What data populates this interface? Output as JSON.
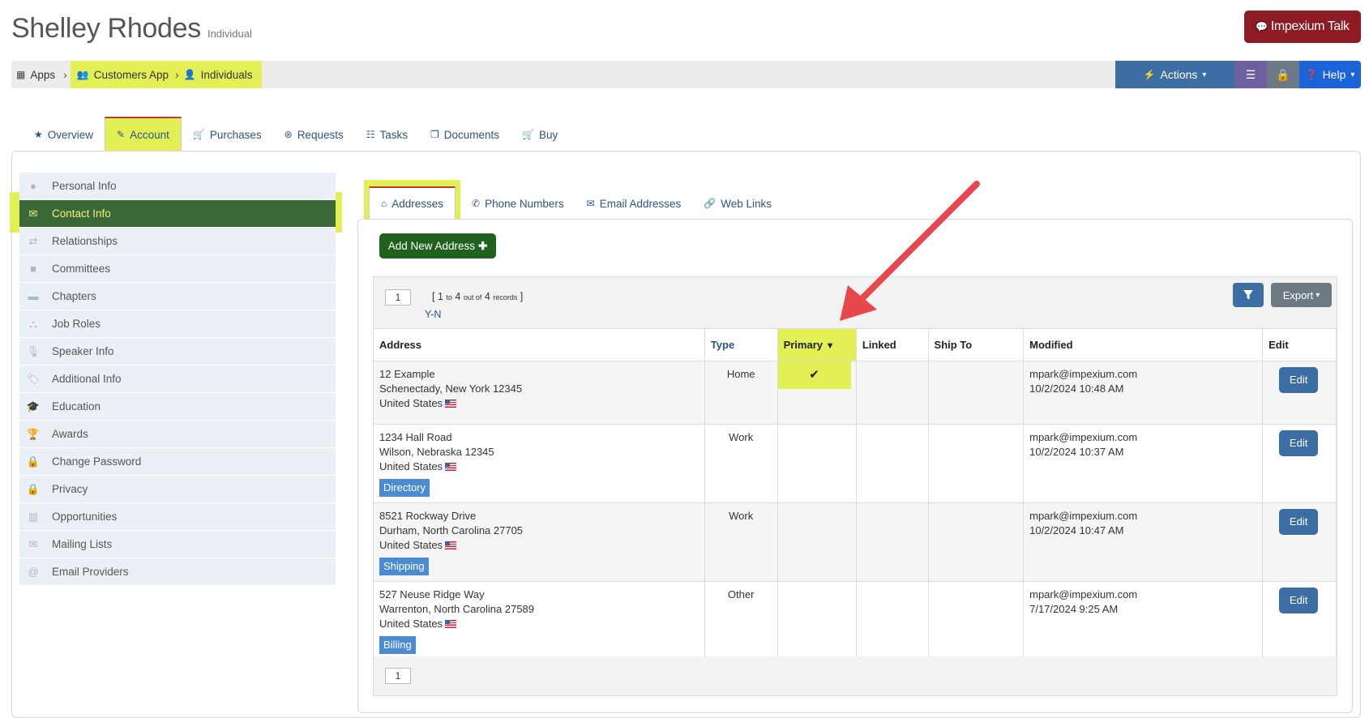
{
  "header": {
    "title": "Shelley Rhodes",
    "subtitle": "Individual",
    "talk_button": "Impexium Talk"
  },
  "breadcrumb": {
    "items": [
      "Apps",
      "Customers App",
      "Individuals"
    ]
  },
  "toolbar": {
    "actions_label": "Actions",
    "help_label": "Help"
  },
  "main_tabs": [
    {
      "label": "Overview",
      "icon": "star-icon"
    },
    {
      "label": "Account",
      "icon": "edit-icon",
      "active": true
    },
    {
      "label": "Purchases",
      "icon": "cart-icon"
    },
    {
      "label": "Requests",
      "icon": "lifebuoy-icon"
    },
    {
      "label": "Tasks",
      "icon": "checklist-icon"
    },
    {
      "label": "Documents",
      "icon": "documents-icon"
    },
    {
      "label": "Buy",
      "icon": "cart-icon"
    }
  ],
  "sidebar": {
    "items": [
      {
        "label": "Personal Info",
        "icon": "user-icon"
      },
      {
        "label": "Contact Info",
        "icon": "envelope-icon",
        "active": true
      },
      {
        "label": "Relationships",
        "icon": "retweet-icon"
      },
      {
        "label": "Committees",
        "icon": "briefcase-icon"
      },
      {
        "label": "Chapters",
        "icon": "archive-icon"
      },
      {
        "label": "Job Roles",
        "icon": "sitemap-icon"
      },
      {
        "label": "Speaker Info",
        "icon": "microphone-icon"
      },
      {
        "label": "Additional Info",
        "icon": "tags-icon"
      },
      {
        "label": "Education",
        "icon": "graduation-cap-icon"
      },
      {
        "label": "Awards",
        "icon": "trophy-icon"
      },
      {
        "label": "Change Password",
        "icon": "lock-icon"
      },
      {
        "label": "Privacy",
        "icon": "lock-icon"
      },
      {
        "label": "Opportunities",
        "icon": "building-icon"
      },
      {
        "label": "Mailing Lists",
        "icon": "envelope-icon"
      },
      {
        "label": "Email Providers",
        "icon": "at-icon"
      }
    ]
  },
  "sub_tabs": [
    {
      "label": "Addresses",
      "icon": "home-icon",
      "active": true
    },
    {
      "label": "Phone Numbers",
      "icon": "phone-icon"
    },
    {
      "label": "Email Addresses",
      "icon": "envelope-icon"
    },
    {
      "label": "Web Links",
      "icon": "link-icon"
    }
  ],
  "add_button": "Add New Address",
  "grid": {
    "page": "1",
    "records": {
      "open": "[",
      "from": "1",
      "to_word": "to",
      "to": "4",
      "out_of_word": "out of",
      "total": "4",
      "records_word": "records",
      "close": "]"
    },
    "filter_value": "Y-N",
    "export_label": "Export",
    "columns": [
      "Address",
      "Type",
      "Primary",
      "Linked",
      "Ship To",
      "Modified",
      "Edit"
    ],
    "rows": [
      {
        "line1": "12 Example",
        "line2": "Schenectady, New York 12345",
        "country": "United States",
        "tag": "",
        "type": "Home",
        "primary": "✔",
        "modified_by": "mpark@impexium.com",
        "modified_at": "10/2/2024 10:48 AM",
        "edit": "Edit"
      },
      {
        "line1": "1234 Hall Road",
        "line2": "Wilson, Nebraska 12345",
        "country": "United States",
        "tag": "Directory",
        "type": "Work",
        "primary": "",
        "modified_by": "mpark@impexium.com",
        "modified_at": "10/2/2024 10:37 AM",
        "edit": "Edit"
      },
      {
        "line1": "8521 Rockway Drive",
        "line2": "Durham, North Carolina 27705",
        "country": "United States",
        "tag": "Shipping",
        "type": "Work",
        "primary": "",
        "modified_by": "mpark@impexium.com",
        "modified_at": "10/2/2024 10:47 AM",
        "edit": "Edit"
      },
      {
        "line1": "527 Neuse Ridge Way",
        "line2": "Warrenton, North Carolina 27589",
        "country": "United States",
        "tag": "Billing",
        "type": "Other",
        "primary": "",
        "modified_by": "mpark@impexium.com",
        "modified_at": "7/17/2024 9:25 AM",
        "edit": "Edit"
      }
    ],
    "footer_page": "1"
  },
  "colors": {
    "highlight": "#e3f055",
    "accent_blue": "#3c6ea3",
    "success_green": "#20621d",
    "talk_red": "#8e1b24",
    "arrow_red": "#e8474c"
  }
}
